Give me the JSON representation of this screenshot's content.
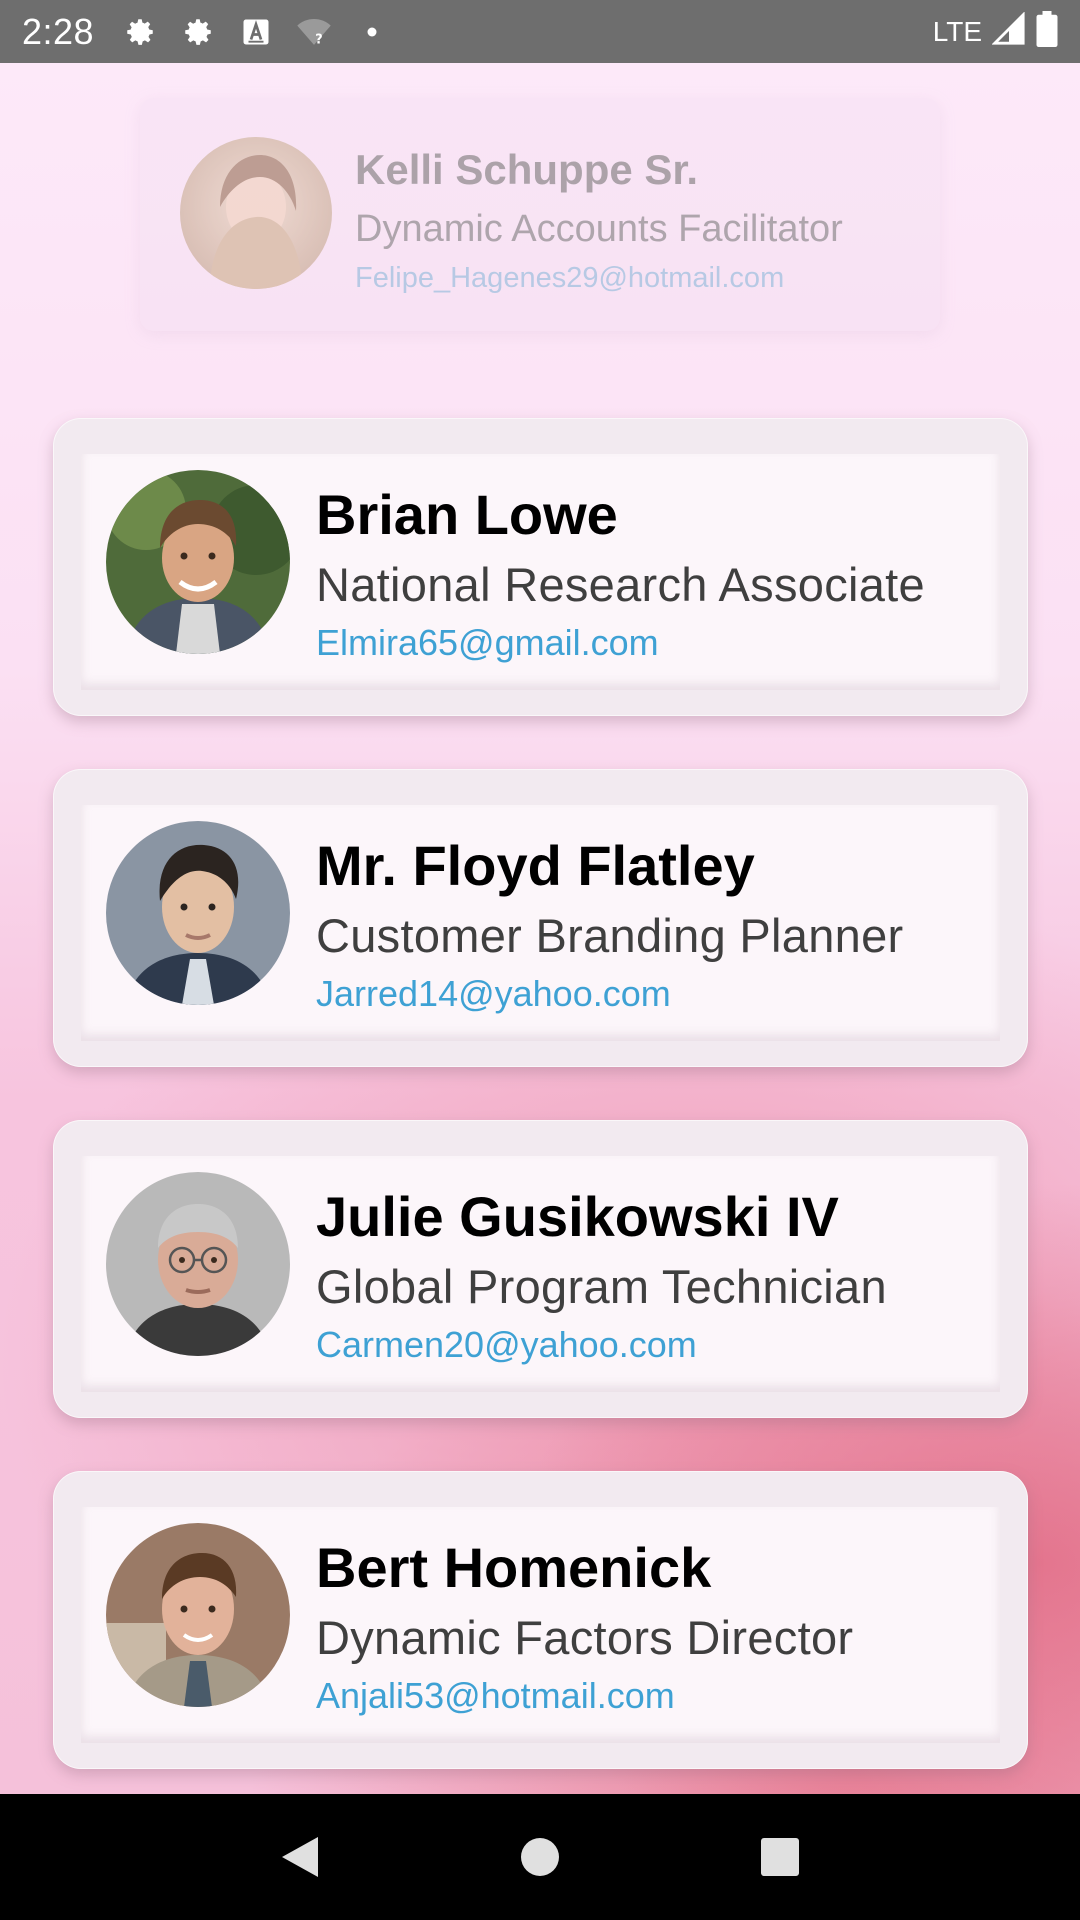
{
  "status_bar": {
    "time": "2:28",
    "network": "LTE",
    "icons": [
      "settings-icon",
      "settings-icon",
      "keyboard-a-icon",
      "wifi-question-icon",
      "dot-icon"
    ]
  },
  "faded_contact": {
    "name": "Kelli Schuppe Sr.",
    "role": "Dynamic Accounts Facilitator",
    "email": "Felipe_Hagenes29@hotmail.com"
  },
  "contacts": [
    {
      "name": "Brian Lowe",
      "role": "National Research Associate",
      "email": "Elmira65@gmail.com"
    },
    {
      "name": "Mr. Floyd Flatley",
      "role": "Customer Branding Planner",
      "email": "Jarred14@yahoo.com"
    },
    {
      "name": "Julie Gusikowski IV",
      "role": "Global Program Technician",
      "email": "Carmen20@yahoo.com"
    },
    {
      "name": "Bert Homenick",
      "role": "Dynamic Factors Director",
      "email": "Anjali53@hotmail.com"
    }
  ],
  "colors": {
    "email": "#3ea1d4",
    "status_bar": "#6e6e6e",
    "nav_bar": "#000000",
    "background_top": "#fde9f9",
    "background_accent": "#e26e87"
  },
  "nav_bar": {
    "buttons": [
      "back-icon",
      "home-icon",
      "recents-icon"
    ]
  }
}
